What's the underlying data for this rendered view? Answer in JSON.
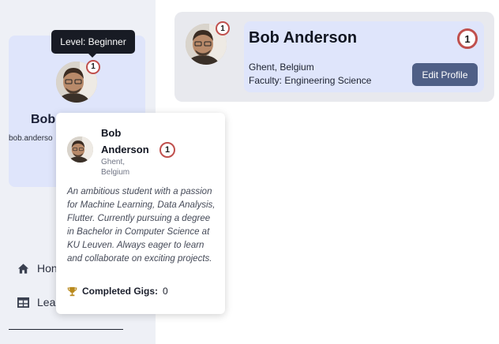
{
  "sidebar": {
    "name": "Bob",
    "email": "bob.anderso",
    "level_badge": "1",
    "nav": [
      {
        "label": "Hon",
        "icon": "home-icon"
      },
      {
        "label": "Lea",
        "icon": "table-icon"
      }
    ]
  },
  "tooltip": {
    "text": "Level: Beginner"
  },
  "profile": {
    "name": "Bob Anderson",
    "location": "Ghent, Belgium",
    "faculty": "Faculty: Engineering Science",
    "level_badge": "1",
    "edit_label": "Edit Profile"
  },
  "popover": {
    "name": "Bob Anderson",
    "location": "Ghent, Belgium",
    "level_badge": "1",
    "bio": "An ambitious student with a passion for Machine Learning, Data Analysis, Flutter. Currently pursuing a degree in Bachelor in Computer Science at KU Leuven. Always eager to learn and collaborate on exciting projects.",
    "gigs_label": "Completed Gigs:",
    "gigs_value": "0"
  },
  "colors": {
    "accent": "#4f5f86",
    "badge_ring": "#c0504d",
    "card_bg": "#dfe5fb",
    "sidebar_bg": "#eef0f6"
  }
}
